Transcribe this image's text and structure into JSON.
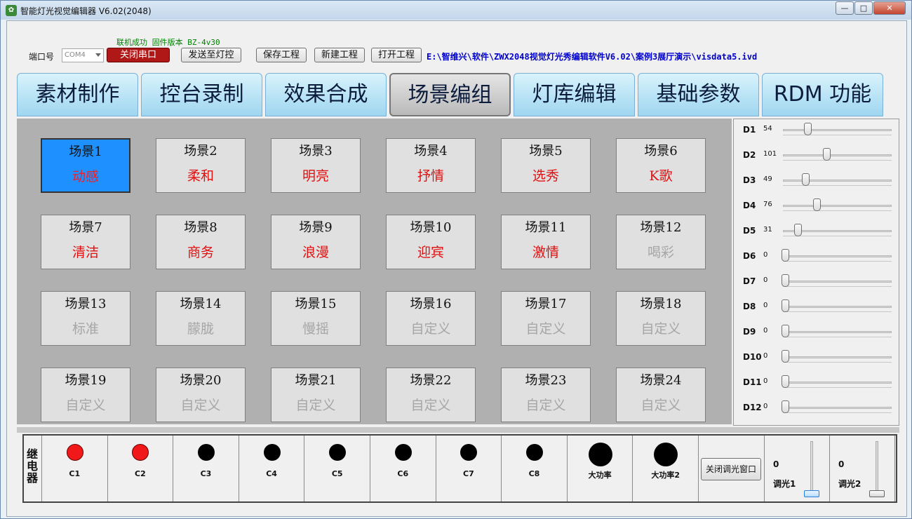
{
  "window": {
    "title": "智能灯光视觉编辑器 V6.02(2048)",
    "icon_glyph": "✿",
    "controls": {
      "minimize": "—",
      "maximize": "□",
      "close": "✕"
    }
  },
  "toolbar": {
    "port_label": "端口号",
    "port_value": "COM4",
    "status": "联机成功 固件版本 BZ-4v30",
    "close_port": "关闭串口",
    "send_to_console": "发送至灯控",
    "save_project": "保存工程",
    "new_project": "新建工程",
    "open_project": "打开工程",
    "file_path": "E:\\智维兴\\软件\\ZWX2048视觉灯光秀编辑软件V6.02\\案例3展厅演示\\visdata5.ivd"
  },
  "tabs": [
    {
      "label": "素材制作"
    },
    {
      "label": "控台录制"
    },
    {
      "label": "效果合成"
    },
    {
      "label": "场景编组",
      "active": true
    },
    {
      "label": "灯库编辑"
    },
    {
      "label": "基础参数"
    },
    {
      "label": "RDM 功能"
    }
  ],
  "scenes": [
    {
      "name": "场景1",
      "desc": "动感",
      "defined": true,
      "selected": true
    },
    {
      "name": "场景2",
      "desc": "柔和",
      "defined": true
    },
    {
      "name": "场景3",
      "desc": "明亮",
      "defined": true
    },
    {
      "name": "场景4",
      "desc": "抒情",
      "defined": true
    },
    {
      "name": "场景5",
      "desc": "选秀",
      "defined": true
    },
    {
      "name": "场景6",
      "desc": "K歌",
      "defined": true
    },
    {
      "name": "场景7",
      "desc": "清洁",
      "defined": true
    },
    {
      "name": "场景8",
      "desc": "商务",
      "defined": true
    },
    {
      "name": "场景9",
      "desc": "浪漫",
      "defined": true
    },
    {
      "name": "场景10",
      "desc": "迎宾",
      "defined": true
    },
    {
      "name": "场景11",
      "desc": "激情",
      "defined": true
    },
    {
      "name": "场景12",
      "desc": "喝彩",
      "defined": false
    },
    {
      "name": "场景13",
      "desc": "标准",
      "defined": false
    },
    {
      "name": "场景14",
      "desc": "朦胧",
      "defined": false
    },
    {
      "name": "场景15",
      "desc": "慢摇",
      "defined": false
    },
    {
      "name": "场景16",
      "desc": "自定义",
      "defined": false
    },
    {
      "name": "场景17",
      "desc": "自定义",
      "defined": false
    },
    {
      "name": "场景18",
      "desc": "自定义",
      "defined": false
    },
    {
      "name": "场景19",
      "desc": "自定义",
      "defined": false
    },
    {
      "name": "场景20",
      "desc": "自定义",
      "defined": false
    },
    {
      "name": "场景21",
      "desc": "自定义",
      "defined": false
    },
    {
      "name": "场景22",
      "desc": "自定义",
      "defined": false
    },
    {
      "name": "场景23",
      "desc": "自定义",
      "defined": false
    },
    {
      "name": "场景24",
      "desc": "自定义",
      "defined": false
    }
  ],
  "dmx_sliders": {
    "max": 255,
    "channels": [
      {
        "label": "D1",
        "value": "54"
      },
      {
        "label": "D2",
        "value": "101"
      },
      {
        "label": "D3",
        "value": "49"
      },
      {
        "label": "D4",
        "value": "76"
      },
      {
        "label": "D5",
        "value": "31"
      },
      {
        "label": "D6",
        "value": "0"
      },
      {
        "label": "D7",
        "value": "0"
      },
      {
        "label": "D8",
        "value": "0"
      },
      {
        "label": "D9",
        "value": "0"
      },
      {
        "label": "D10",
        "value": "0"
      },
      {
        "label": "D11",
        "value": "0"
      },
      {
        "label": "D12",
        "value": "0"
      }
    ]
  },
  "relays": {
    "label": "继电器",
    "items": [
      {
        "name": "C1",
        "on": true
      },
      {
        "name": "C2",
        "on": true
      },
      {
        "name": "C3",
        "on": false
      },
      {
        "name": "C4",
        "on": false
      },
      {
        "name": "C5",
        "on": false
      },
      {
        "name": "C6",
        "on": false
      },
      {
        "name": "C7",
        "on": false
      },
      {
        "name": "C8",
        "on": false
      },
      {
        "name": "大功率",
        "on": false,
        "large": true
      },
      {
        "name": "大功率2",
        "on": false,
        "large": true
      }
    ],
    "close_dim_window": "关闭调光窗口"
  },
  "dimmers": [
    {
      "label": "调光1",
      "value": "0",
      "level": 0
    },
    {
      "label": "调光2",
      "value": "0",
      "level": 0
    }
  ],
  "colors": {
    "selected_scene": "#1e90ff",
    "scene_desc_defined": "#e01010",
    "scene_desc_undefined": "#a6a6a6",
    "relay_on": "#f01818",
    "relay_off": "#000000",
    "path_text": "#0000cc"
  }
}
